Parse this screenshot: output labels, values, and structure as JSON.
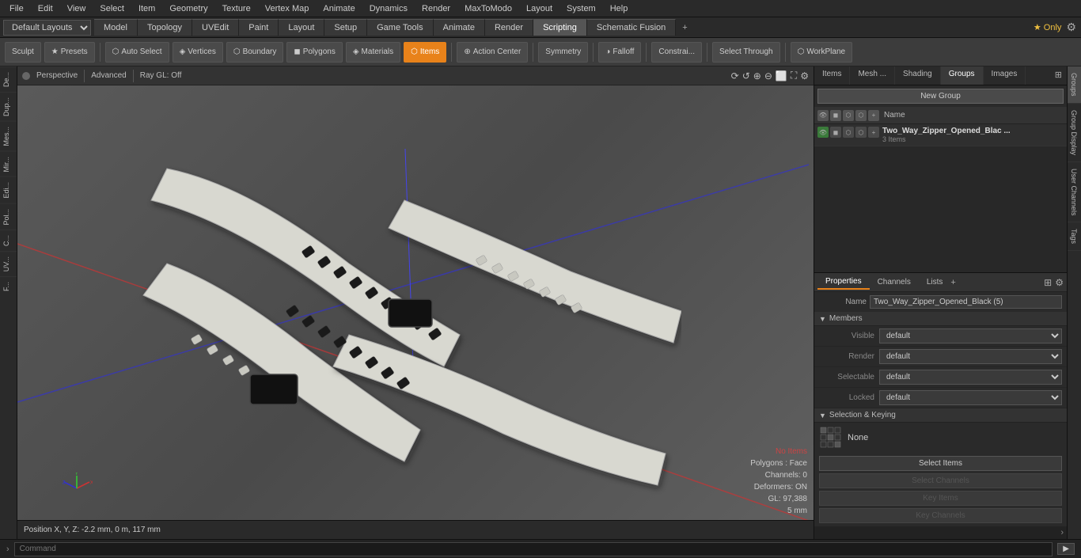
{
  "menu": {
    "items": [
      "File",
      "Edit",
      "View",
      "Select",
      "Item",
      "Geometry",
      "Texture",
      "Vertex Map",
      "Animate",
      "Dynamics",
      "Render",
      "MaxToModo",
      "Layout",
      "System",
      "Help"
    ]
  },
  "layout_bar": {
    "dropdown": "Default Layouts",
    "tabs": [
      "Model",
      "Topology",
      "UVEdit",
      "Paint",
      "Layout",
      "Setup",
      "Game Tools",
      "Animate",
      "Render",
      "Scripting",
      "Schematic Fusion"
    ],
    "active_tab": "Scripting",
    "star_only": "★ Only",
    "settings_icon": "⚙"
  },
  "toolbar": {
    "sculpt_label": "Sculpt",
    "presets_label": "Presets",
    "auto_select_label": "Auto Select",
    "vertices_label": "Vertices",
    "boundary_label": "Boundary",
    "polygons_label": "Polygons",
    "materials_label": "Materials",
    "items_label": "Items",
    "action_center_label": "Action Center",
    "symmetry_label": "Symmetry",
    "falloff_label": "Falloff",
    "constrai_label": "Constrai...",
    "select_through_label": "Select Through",
    "workplane_label": "WorkPlane"
  },
  "viewport": {
    "dot_color": "#666",
    "mode": "Perspective",
    "advanced_label": "Advanced",
    "ray_gl": "Ray GL: Off",
    "status": {
      "no_items": "No Items",
      "polygons": "Polygons : Face",
      "channels": "Channels: 0",
      "deformers": "Deformers: ON",
      "gl": "GL: 97,388",
      "size": "5 mm"
    }
  },
  "position_bar": {
    "text": "Position X, Y, Z:  -2.2 mm, 0 m, 117 mm"
  },
  "right_panel": {
    "tabs": [
      "Items",
      "Mesh ...",
      "Shading",
      "Groups",
      "Images"
    ],
    "active_tab": "Groups",
    "expand_icon": "⊞",
    "new_group_btn": "New Group",
    "table_header": {
      "name_label": "Name"
    },
    "groups": [
      {
        "name": "Two_Way_Zipper_Opened_Blac ...",
        "count": "3 Items"
      }
    ]
  },
  "properties": {
    "tabs": [
      "Properties",
      "Channels",
      "Lists"
    ],
    "active_tab": "Properties",
    "name_label": "Name",
    "name_value": "Two_Way_Zipper_Opened_Black (5)",
    "members_label": "Members",
    "fields": [
      {
        "label": "Visible",
        "value": "default"
      },
      {
        "label": "Render",
        "value": "default"
      },
      {
        "label": "Selectable",
        "value": "default"
      },
      {
        "label": "Locked",
        "value": "default"
      }
    ],
    "selection_keying_label": "Selection & Keying",
    "none_label": "None",
    "buttons": [
      {
        "label": "Select Items",
        "disabled": false
      },
      {
        "label": "Select Channels",
        "disabled": true
      },
      {
        "label": "Key Items",
        "disabled": true
      },
      {
        "label": "Key Channels",
        "disabled": true
      }
    ]
  },
  "right_sidebar_tabs": [
    "Groups",
    "Group Display",
    "User Channels",
    "Tags"
  ],
  "command_bar": {
    "label": "Command",
    "placeholder": "Command",
    "go_label": "▶"
  },
  "left_tabs": [
    "De...",
    "Dup...",
    "Mes...",
    "Mir...",
    "Edi...",
    "Pol...",
    "C...",
    "UV...",
    "F..."
  ]
}
